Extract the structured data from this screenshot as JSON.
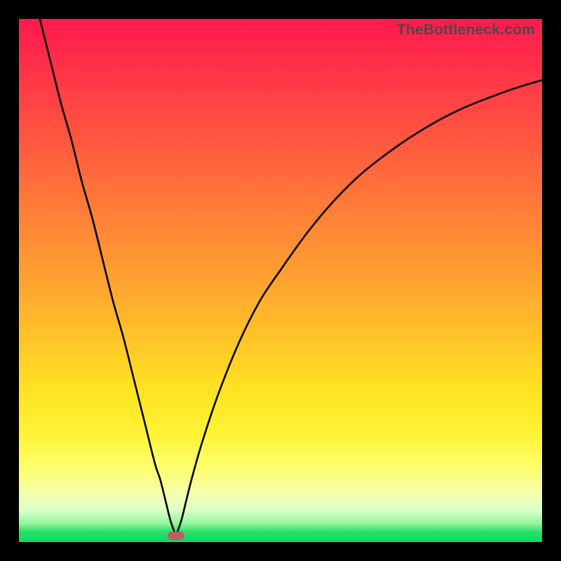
{
  "watermark": "TheBottleneck.com",
  "colors": {
    "page_bg": "#000000",
    "curve": "#000000",
    "marker": "#bb5f5f",
    "gradient_top": "#ff1a4d",
    "gradient_bottom": "#0fd85f"
  },
  "chart_data": {
    "type": "line",
    "title": "",
    "xlabel": "",
    "ylabel": "",
    "xlim": [
      0,
      100
    ],
    "ylim": [
      0,
      100
    ],
    "grid": false,
    "legend": false,
    "notch_x": 30,
    "marker": {
      "x": 30,
      "y": 1.2
    },
    "series": [
      {
        "name": "left-branch",
        "x": [
          4,
          6,
          8,
          10,
          12,
          14,
          16,
          18,
          20,
          22,
          24,
          26,
          27,
          28,
          29,
          30
        ],
        "y": [
          100,
          92,
          84,
          77,
          69,
          62,
          54,
          46,
          39,
          31,
          23,
          15,
          12,
          8,
          4,
          1.2
        ]
      },
      {
        "name": "right-branch",
        "x": [
          30,
          31,
          32,
          33,
          35,
          38,
          42,
          46,
          50,
          55,
          60,
          65,
          70,
          75,
          80,
          85,
          90,
          95,
          100
        ],
        "y": [
          1.2,
          4,
          8,
          12,
          19,
          28,
          38,
          46,
          52,
          59,
          65,
          70,
          74,
          77.5,
          80.5,
          83,
          85,
          86.8,
          88.3
        ]
      }
    ]
  }
}
